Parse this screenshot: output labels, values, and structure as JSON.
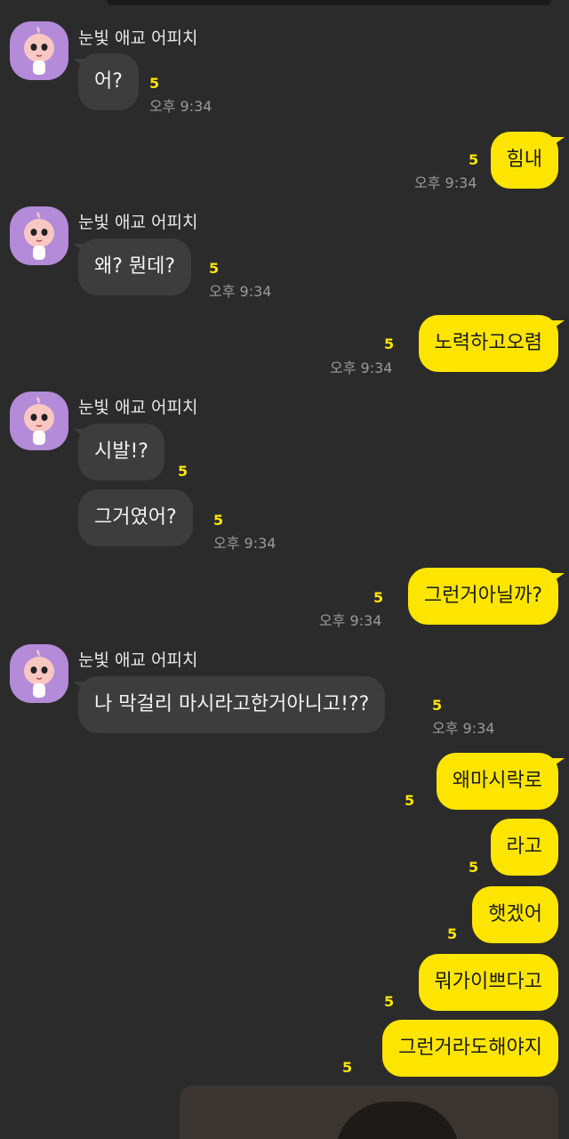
{
  "chat": {
    "contact_name": "눈빛 애교 어피치",
    "read_count": "5",
    "messages": [
      {
        "text": "어?",
        "time": "오후 9:34"
      },
      {
        "text": "힘내",
        "time": "오후 9:34"
      },
      {
        "text": "왜? 뭔데?",
        "time": "오후 9:34"
      },
      {
        "text": "노력하고오렴",
        "time": "오후 9:34"
      },
      {
        "text": "시발!?"
      },
      {
        "text": "그거였어?",
        "time": "오후 9:34"
      },
      {
        "text": "그런거아닐까?",
        "time": "오후 9:34"
      },
      {
        "text": "나 막걸리 마시라고한거아니고!??",
        "time": "오후 9:34"
      },
      {
        "text": "왜마시락로"
      },
      {
        "text": "라고"
      },
      {
        "text": "햇겠어"
      },
      {
        "text": "뭐가이쁘다고"
      },
      {
        "text": "그런거라도해야지"
      }
    ]
  },
  "colors": {
    "background": "#2b2b2b",
    "my_bubble": "#fee500",
    "their_bubble": "#3d3d3d",
    "unread_count": "#fee500",
    "avatar_bg": "#b38bd8"
  },
  "icons": {
    "avatar": "apeach-avatar-icon"
  }
}
